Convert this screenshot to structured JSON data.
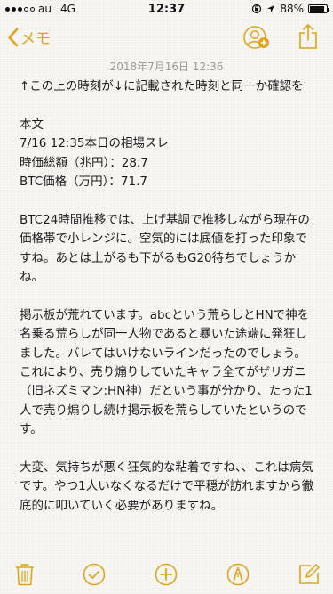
{
  "status_bar": {
    "carrier": "au",
    "network": "4G",
    "time": "12:37",
    "battery_text": "88%",
    "battery_level": 0.88
  },
  "nav": {
    "back_label": "メモ",
    "accent_color": "#e0a31c"
  },
  "note": {
    "date": "2018年7月16日 12:36",
    "lines": [
      "↑この上の時刻が↓に記載された時刻と同一か確認を",
      "",
      "本文",
      "7/16 12:35本日の相場スレ",
      "時価総額（兆円）：28.7",
      "BTC価格（万円）：71.7",
      "",
      "BTC24時間推移では、上げ基調で推移しながら現在の価格帯で小レンジに。空気的には底値を打った印象ですね。あとは上がるも下がるもG20待ちでしょうかね。",
      "",
      "掲示板が荒れています。abcという荒らしとHNで神を名乗る荒らしが同一人物であると暴いた途端に発狂しました。バレてはいけないラインだったのでしょう。これにより、売り煽りしていたキャラ全てがザリガニ（旧ネズミマン:HN神）だという事が分かり、たった1人で売り煽りし続け掲示板を荒らしていたというのです。",
      "",
      "大変、気持ちが悪く狂気的な粘着ですね、、これは病気です。やつ1人いなくなるだけで平穏が訪れますから徹底的に叩いていく必要がありますね。"
    ]
  },
  "icons": {
    "back": "chevron-left-icon",
    "add_person": "add-person-icon",
    "share": "share-icon",
    "trash": "trash-icon",
    "checklist": "checkmark-circle-icon",
    "add": "plus-circle-icon",
    "sketch": "pen-marker-icon",
    "compose": "compose-icon"
  }
}
